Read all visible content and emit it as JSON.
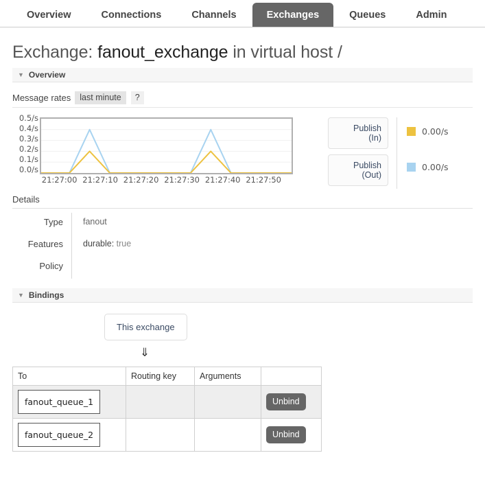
{
  "nav": {
    "tabs": [
      {
        "label": "Overview",
        "active": false
      },
      {
        "label": "Connections",
        "active": false
      },
      {
        "label": "Channels",
        "active": false
      },
      {
        "label": "Exchanges",
        "active": true
      },
      {
        "label": "Queues",
        "active": false
      },
      {
        "label": "Admin",
        "active": false
      }
    ]
  },
  "page": {
    "title_prefix": "Exchange:",
    "exchange_name": "fanout_exchange",
    "title_middle": "in virtual host",
    "vhost": "/"
  },
  "overview": {
    "section_label": "Overview",
    "caret": "▼",
    "rates_label": "Message rates",
    "period_chip": "last minute",
    "help_chip": "?"
  },
  "chart_data": {
    "type": "line",
    "title": "Message rates",
    "xlabel": "",
    "ylabel": "",
    "ylim": [
      0.0,
      0.5
    ],
    "yticks": [
      "0.5/s",
      "0.4/s",
      "0.3/s",
      "0.2/s",
      "0.1/s",
      "0.0/s"
    ],
    "ytick_values": [
      0.5,
      0.4,
      0.3,
      0.2,
      0.1,
      0.0
    ],
    "xticks": [
      "21:27:00",
      "21:27:10",
      "21:27:20",
      "21:27:30",
      "21:27:40",
      "21:27:50"
    ],
    "xtick_seconds": [
      0,
      10,
      20,
      30,
      40,
      50
    ],
    "xlim": [
      -5,
      57
    ],
    "grid": true,
    "legend_position": "right",
    "series": [
      {
        "name": "Publish (In)",
        "color": "#edc240",
        "current_rate": "0.00/s",
        "x": [
          -5,
          2,
          7,
          12,
          32,
          37,
          42,
          57
        ],
        "y": [
          0.0,
          0.0,
          0.2,
          0.0,
          0.0,
          0.2,
          0.0,
          0.0
        ]
      },
      {
        "name": "Publish (Out)",
        "color": "#a8d3f0",
        "current_rate": "0.00/s",
        "x": [
          -5,
          2,
          7,
          12,
          32,
          37,
          42,
          57
        ],
        "y": [
          0.0,
          0.0,
          0.4,
          0.0,
          0.0,
          0.4,
          0.0,
          0.0
        ]
      }
    ]
  },
  "legend": {
    "buttons": [
      {
        "line1": "Publish",
        "line2": "(In)"
      },
      {
        "line1": "Publish",
        "line2": "(Out)"
      }
    ],
    "values": [
      {
        "swatch": "#edc240",
        "text": "0.00/s"
      },
      {
        "swatch": "#a8d3f0",
        "text": "0.00/s"
      }
    ]
  },
  "details": {
    "heading": "Details",
    "rows": [
      {
        "key": "Type",
        "value": "fanout",
        "kind": "plain"
      },
      {
        "key": "Features",
        "feature_key": "durable:",
        "feature_value": "true",
        "kind": "feature"
      },
      {
        "key": "Policy",
        "value": "",
        "kind": "plain"
      }
    ]
  },
  "bindings": {
    "section_label": "Bindings",
    "caret": "▼",
    "this_exchange_label": "This exchange",
    "arrow_glyph": "⇓",
    "columns": [
      "To",
      "Routing key",
      "Arguments",
      ""
    ],
    "rows": [
      {
        "to": "fanout_queue_1",
        "routing_key": "",
        "arguments": "",
        "action": "Unbind"
      },
      {
        "to": "fanout_queue_2",
        "routing_key": "",
        "arguments": "",
        "action": "Unbind"
      }
    ]
  }
}
